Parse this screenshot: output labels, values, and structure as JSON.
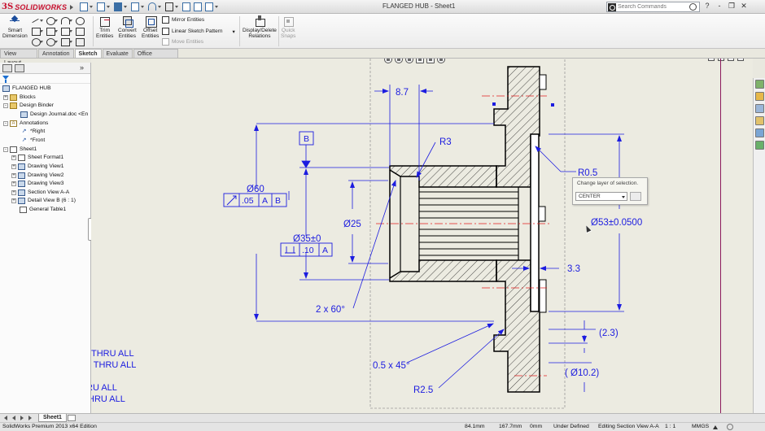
{
  "app": {
    "logo_brand": "SOLIDWORKS",
    "document_title": "FLANGED HUB - Sheet1",
    "search_placeholder": "Search Commands",
    "window_controls": [
      "?",
      "-",
      "❐",
      "✕"
    ]
  },
  "command_manager": {
    "smart_dimension": [
      "Smart",
      "Dimension"
    ],
    "trim_entities": [
      "Trim",
      "Entities"
    ],
    "convert_entities": [
      "Convert",
      "Entities"
    ],
    "offset_entities": [
      "Offset",
      "Entities"
    ],
    "mirror_entities": "Mirror Entities",
    "linear_sketch_pattern": "Linear Sketch Pattern",
    "move_entities": "Move Entities",
    "display_delete_relations": [
      "Display/Delete",
      "Relations"
    ],
    "quick_snaps": [
      "Quick",
      "Snaps"
    ]
  },
  "tabs": [
    {
      "label": "View Layout",
      "active": false
    },
    {
      "label": "Annotation",
      "active": false
    },
    {
      "label": "Sketch",
      "active": true
    },
    {
      "label": "Evaluate",
      "active": false
    },
    {
      "label": "Office Products",
      "active": false
    }
  ],
  "tree": {
    "items": [
      {
        "label": "FLANGED HUB"
      },
      {
        "label": "Blocks"
      },
      {
        "label": "Design Binder"
      },
      {
        "label": "Design Journal.doc <En"
      },
      {
        "label": "Annotations"
      },
      {
        "label": "*Right"
      },
      {
        "label": "*Front"
      },
      {
        "label": "Sheet1"
      },
      {
        "label": "Sheet Format1"
      },
      {
        "label": "Drawing View1"
      },
      {
        "label": "Drawing View2"
      },
      {
        "label": "Drawing View3"
      },
      {
        "label": "Section View A-A"
      },
      {
        "label": "Detail View B (6 : 1)"
      },
      {
        "label": "General Table1"
      }
    ]
  },
  "drawing": {
    "dims": {
      "d_8_7": "8.7",
      "r3": "R3",
      "r0_5": "R0.5",
      "d60": "Ø60",
      "d25": "Ø25",
      "d35": "Ø35±0",
      "d53": "Ø53±0.0500",
      "d3_3": "3.3",
      "chamfer_2x60": "2 x 60°",
      "d2_3": "(2.3)",
      "chamfer_0_5x45": "0.5 x 45°",
      "d10_2": "( Ø10.2)",
      "r2_5": "R2.5"
    },
    "datum_b": "B",
    "fcf_runout": {
      "value": ".05",
      "datum1": "A",
      "datum2": "B"
    },
    "fcf_flat": {
      "value": ".10",
      "datum": "A"
    },
    "notes": [
      "THRU ALL",
      "C  THRU ALL",
      "RU ALL",
      "HRU ALL"
    ],
    "colors": {
      "annotation": "#1c1ce0",
      "geometry": "#000000",
      "centerline": "#e02020",
      "sheet_edge": "#8c1a5c"
    }
  },
  "layer_popup": {
    "label": "Change layer of selection.",
    "value": "CENTER"
  },
  "sheet_tab": "Sheet1",
  "status": {
    "edition": "SolidWorks Premium 2013 x64 Edition",
    "x": "84.1mm",
    "y": "167.7mm",
    "z": "0mm",
    "state": "Under Defined",
    "editing": "Editing Section View A-A",
    "scale": "1 : 1",
    "units": "MMGS"
  }
}
